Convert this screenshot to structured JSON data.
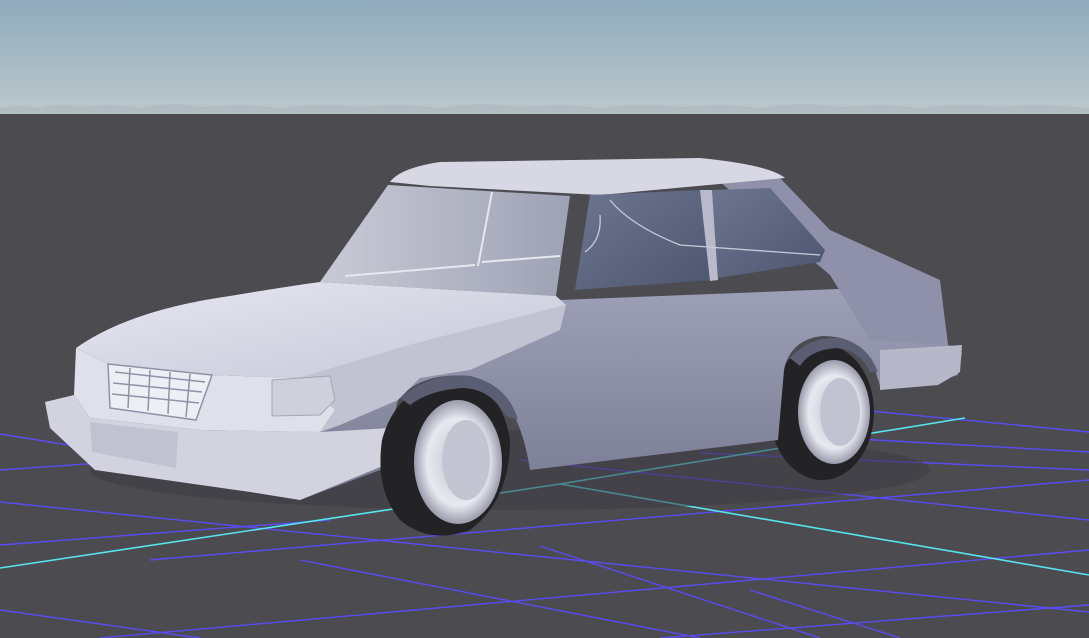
{
  "viewport": {
    "view": "3d-scene",
    "model": "car-hatchback-untextured",
    "colors": {
      "sky_top": "#93aec1",
      "sky_bottom": "#b8c6cb",
      "ground": "#4b4b50",
      "grid_line": "#5a4cf2",
      "grid_axis": "#56e6ee",
      "car_body_light": "#dcdde8",
      "car_body_mid": "#a9abc0",
      "car_body_dark": "#7b7e96",
      "glass": "#56607a",
      "tire": "#232326",
      "rim": "#e9eaf0"
    },
    "icons": [
      "car-model",
      "ground-grid"
    ]
  }
}
